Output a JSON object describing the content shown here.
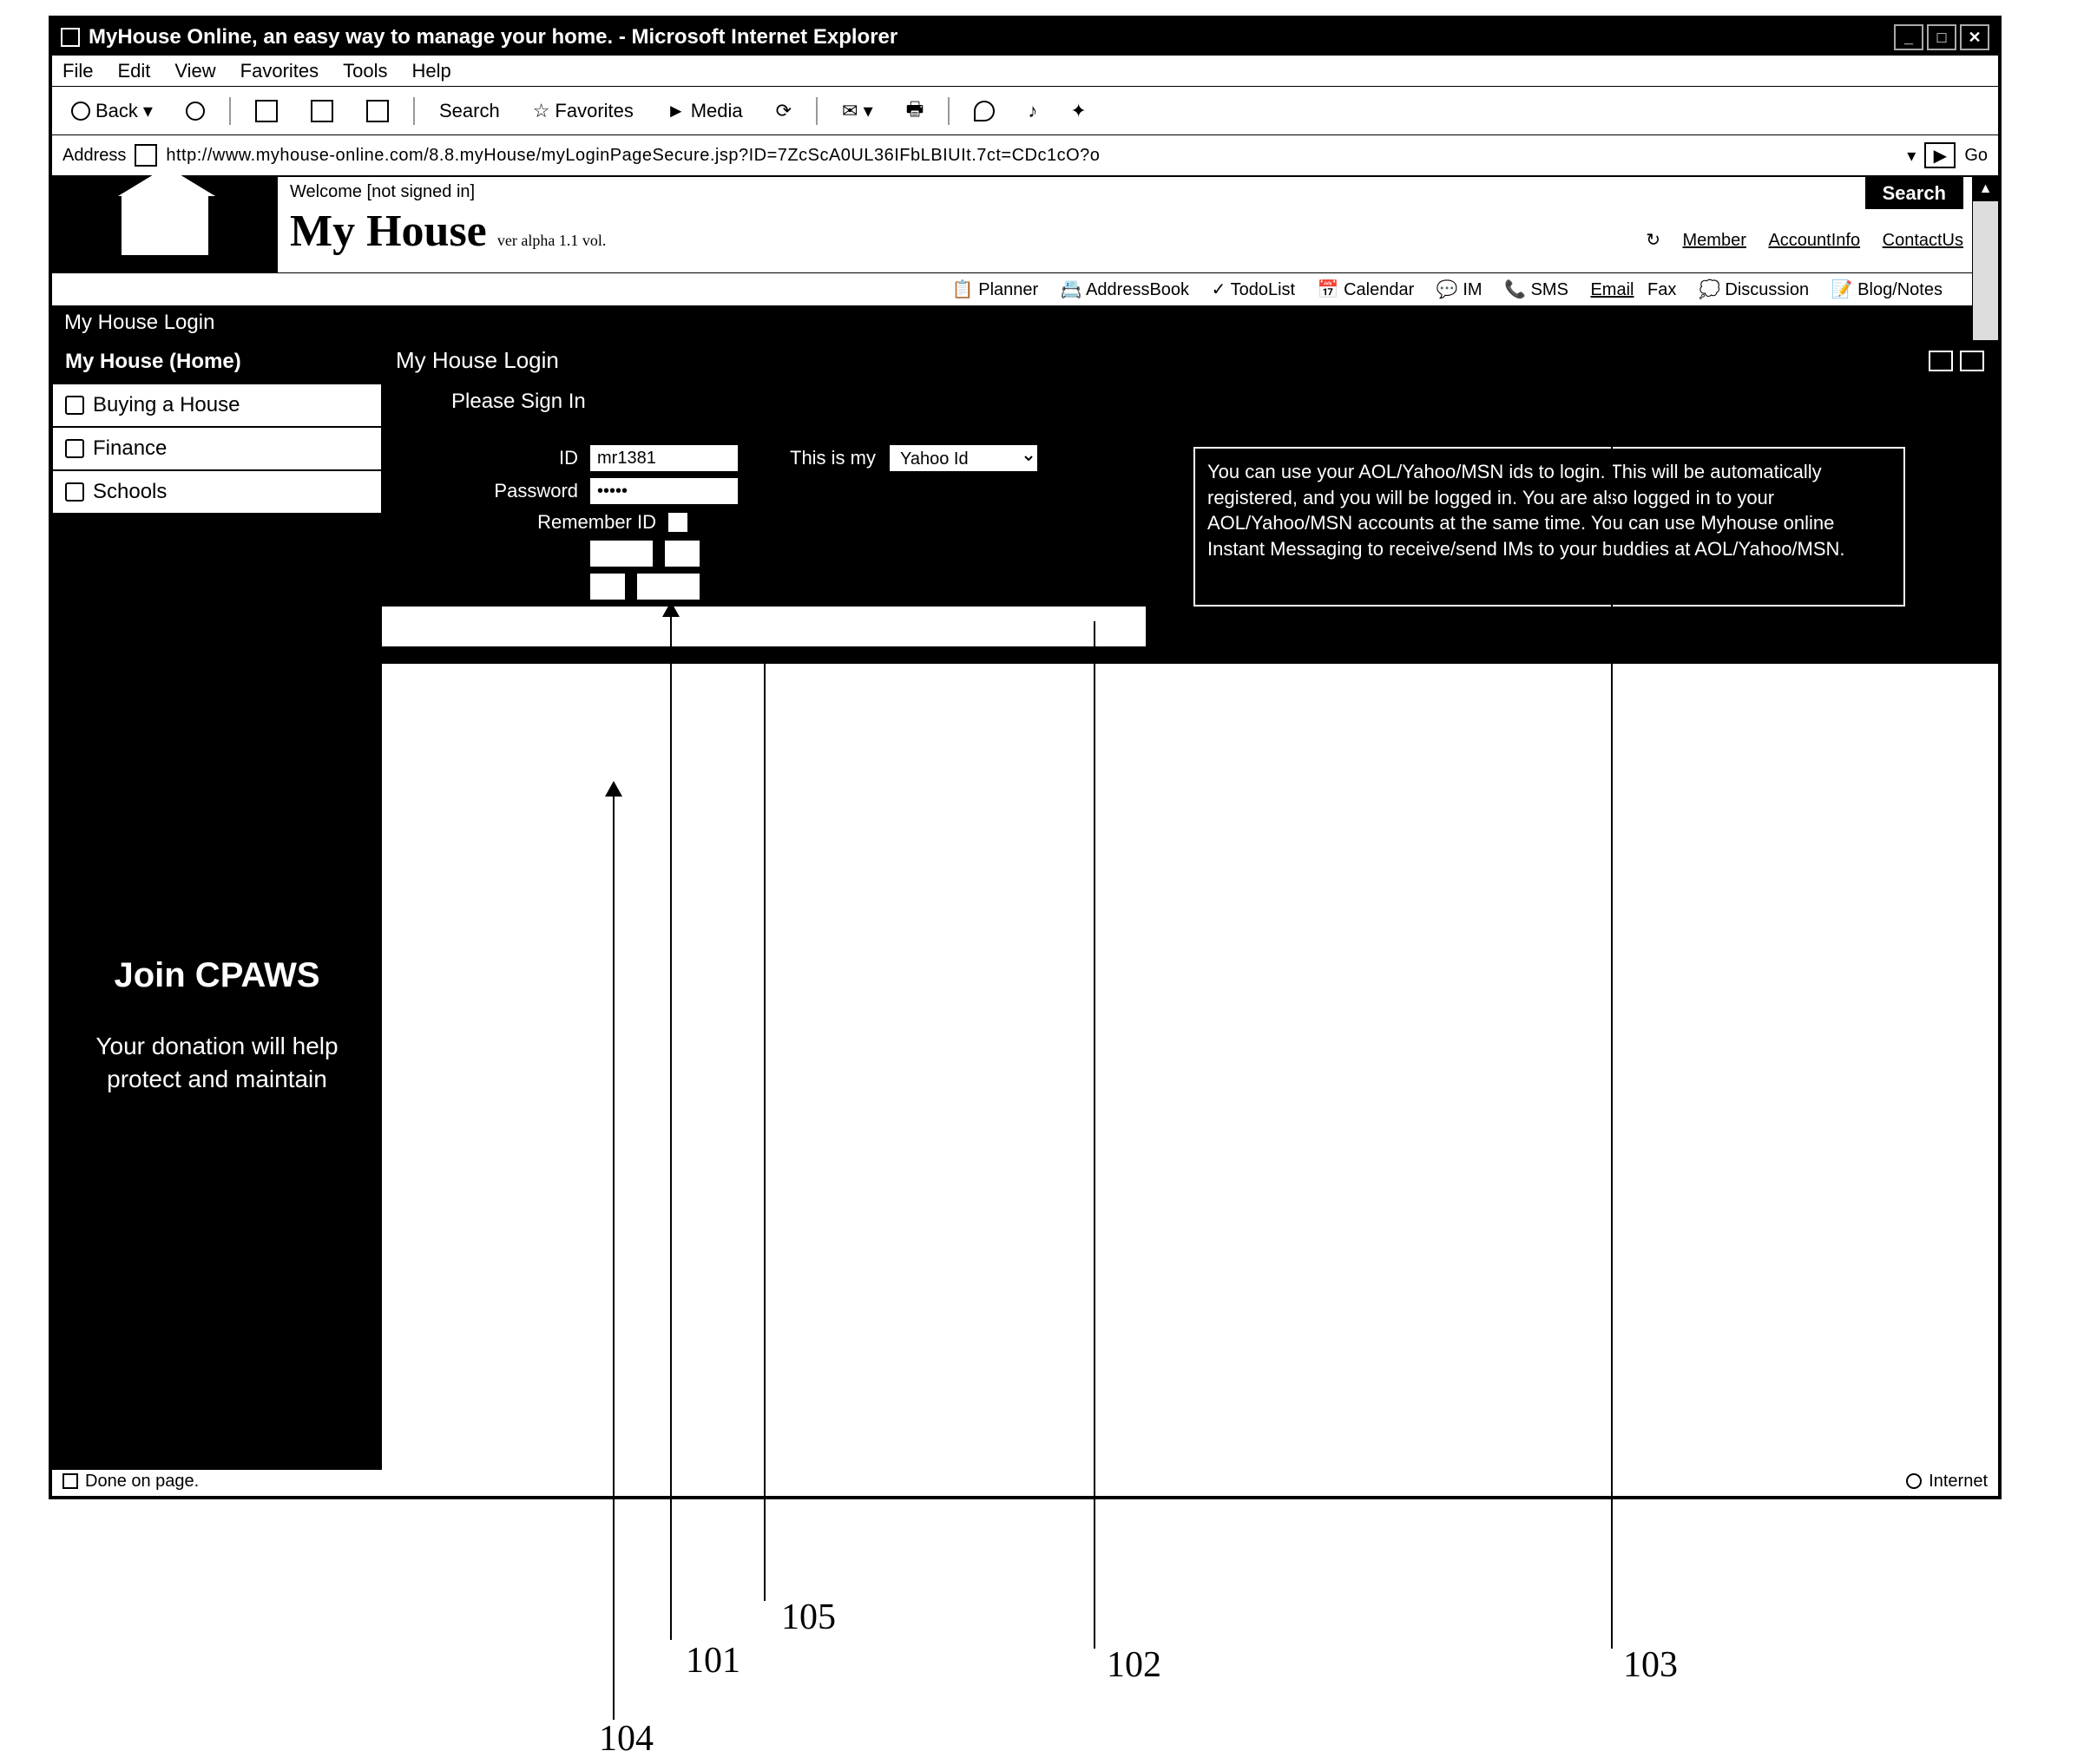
{
  "titlebar": {
    "caption": "MyHouse Online, an easy way to manage your home. - Microsoft Internet Explorer"
  },
  "menu": {
    "file": "File",
    "edit": "Edit",
    "view": "View",
    "favorites": "Favorites",
    "tools": "Tools",
    "help": "Help"
  },
  "toolbar": {
    "back": "Back",
    "search": "Search",
    "favorites": "Favorites",
    "media": "Media"
  },
  "address": {
    "label": "Address",
    "url": "http://www.myhouse-online.com/8.8.myHouse/myLoginPageSecure.jsp?ID=7ZcScA0UL36IFbLBIUIt.7ct=CDc1cO?o",
    "go": "Go"
  },
  "header": {
    "welcome": "Welcome [not signed in]",
    "title": "My House",
    "version": "ver alpha 1.1 vol.",
    "search": "Search",
    "links": {
      "member": "Member",
      "account": "AccountInfo",
      "contact": "ContactUs"
    },
    "tools": {
      "planner": "Planner",
      "addr": "AddressBook",
      "todo": "TodoList",
      "cal": "Calendar",
      "im": "IM",
      "sms": "SMS",
      "email": "Email",
      "fax": "Fax",
      "disc": "Discussion",
      "blog": "Blog/Notes"
    }
  },
  "nav": {
    "bar": "My House Login",
    "items": [
      {
        "label": "My House (Home)",
        "sel": true
      },
      {
        "label": "Buying a House",
        "sel": false
      },
      {
        "label": "Finance",
        "sel": false
      },
      {
        "label": "Schools",
        "sel": false
      }
    ]
  },
  "ad": {
    "title": "Join CPAWS",
    "body": "Your donation will help protect and maintain"
  },
  "login": {
    "title": "My House Login",
    "section": "Please Sign In",
    "id_label": "ID",
    "id_value": "mr1381",
    "thisis": "This is my",
    "provider": "Yahoo Id",
    "pw_label": "Password",
    "pw_value": "•••••",
    "remember": "Remember ID",
    "info": "You can use your AOL/Yahoo/MSN ids to login. This will be automatically registered, and you will be logged in. You are also logged in to your AOL/Yahoo/MSN accounts at the same time. You can use Myhouse online Instant Messaging to receive/send IMs to your buddies at AOL/Yahoo/MSN."
  },
  "status": {
    "left": "Done on page.",
    "right": "Internet"
  },
  "callouts": {
    "c101": "101",
    "c102": "102",
    "c103": "103",
    "c104": "104",
    "c105": "105"
  }
}
